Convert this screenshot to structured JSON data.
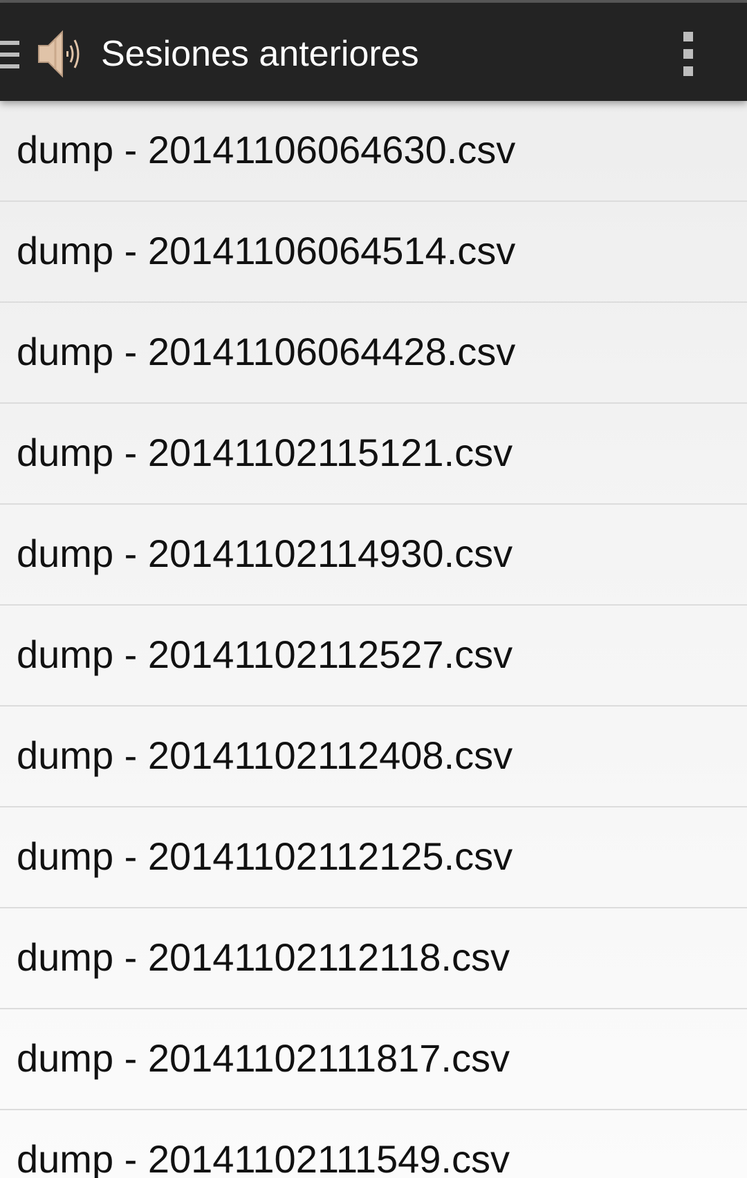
{
  "theme": {
    "actionbar_bg": "#232323",
    "title_color": "#ffffff",
    "list_text": "#111111",
    "divider": "#dcdcdc",
    "app_icon_color": "#e0c3a8"
  },
  "actionbar": {
    "title": "Sesiones anteriores",
    "drawer_icon": "menu-icon",
    "app_icon": "speaker-icon",
    "overflow_icon": "more-vertical-icon"
  },
  "sessions": {
    "items": [
      {
        "label": "dump - 20141106064630.csv"
      },
      {
        "label": "dump - 20141106064514.csv"
      },
      {
        "label": "dump - 20141106064428.csv"
      },
      {
        "label": "dump - 20141102115121.csv"
      },
      {
        "label": "dump - 20141102114930.csv"
      },
      {
        "label": "dump - 20141102112527.csv"
      },
      {
        "label": "dump - 20141102112408.csv"
      },
      {
        "label": "dump - 20141102112125.csv"
      },
      {
        "label": "dump - 20141102112118.csv"
      },
      {
        "label": "dump - 20141102111817.csv"
      },
      {
        "label": "dump - 20141102111549.csv"
      }
    ]
  }
}
